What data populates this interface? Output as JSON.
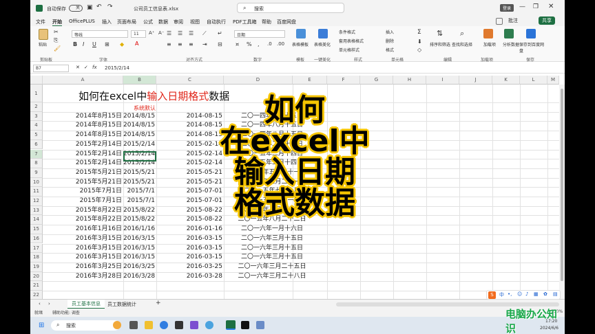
{
  "titlebar": {
    "autosave": "自动保存",
    "autosave_state": "关",
    "filename": "公司员工信息表.xlsx",
    "search": "搜索",
    "user": "登录",
    "share": "共享"
  },
  "tabs": [
    "文件",
    "开始",
    "OfficePLUS",
    "插入",
    "页面布局",
    "公式",
    "数据",
    "审阅",
    "视图",
    "自动执行",
    "PDF工具箱",
    "帮助",
    "百度网盘"
  ],
  "ribbon": {
    "paste": "粘贴",
    "clipboard": "剪贴板",
    "font_name": "等线",
    "font_size": "11",
    "font": "字体",
    "align": "对齐方式",
    "num_format": "日期",
    "number": "数字",
    "template": "表格模板",
    "template_group": "模板",
    "beautify": "表格美化",
    "beautify_group": "一键美化",
    "cond": "条件格式",
    "table_fmt": "套用表格格式",
    "cell_style": "单元格样式",
    "style": "样式",
    "insert": "插入",
    "delete": "删除",
    "format": "格式",
    "cells": "单元格",
    "sort": "排序和筛选",
    "find": "查找和选择",
    "edit": "编辑",
    "addin": "加载项",
    "addin_group": "加载项",
    "analyze": "分析数据",
    "save_baidu": "保存到百度网盘",
    "save": "保存",
    "bold": "B",
    "italic": "I",
    "underline": "U",
    "percent": "%",
    "comma": ","
  },
  "formula_bar": {
    "name_box": "B7",
    "fx": "fx",
    "value": "2015/2/14"
  },
  "columns": [
    "A",
    "B",
    "C",
    "D",
    "E",
    "F",
    "G",
    "H",
    "I",
    "J",
    "K",
    "L",
    "M"
  ],
  "rows": [
    "1",
    "2",
    "3",
    "4",
    "5",
    "6",
    "7",
    "8",
    "9",
    "10",
    "11",
    "12",
    "13",
    "14",
    "15",
    "16",
    "17",
    "18",
    "19",
    "20",
    "21",
    "22"
  ],
  "sheet": {
    "title_black_a": "如何在excel中",
    "title_red": "输入日期格式",
    "title_black_b": "数据",
    "b2": "系统默认",
    "data": [
      [
        "2014年8月15日",
        "2014/8/15",
        "2014-08-15",
        "二〇一四年八月十五日"
      ],
      [
        "2014年8月15日",
        "2014/8/15",
        "2014-08-15",
        "二〇一四年八月十五日"
      ],
      [
        "2014年8月15日",
        "2014/8/15",
        "2014-08-15",
        "二〇一四年八月十五日"
      ],
      [
        "2015年2月14日",
        "2015/2/14",
        "2015-02-14",
        "二〇一五年二月十四日"
      ],
      [
        "2015年2月14日",
        "2015/2/14",
        "2015-02-14",
        "二〇一五年二月十四日"
      ],
      [
        "2015年2月14日",
        "2015/2/14",
        "2015-02-14",
        "二〇一五年二月十四日"
      ],
      [
        "2015年5月21日",
        "2015/5/21",
        "2015-05-21",
        "二〇一五年五月二十一日"
      ],
      [
        "2015年5月21日",
        "2015/5/21",
        "2015-05-21",
        "二〇一五年五月二十一日"
      ],
      [
        "2015年7月1日",
        "2015/7/1",
        "2015-07-01",
        "二〇一五年七月一日"
      ],
      [
        "2015年7月1日",
        "2015/7/1",
        "2015-07-01",
        "二〇一五年七月一日"
      ],
      [
        "2015年8月22日",
        "2015/8/22",
        "2015-08-22",
        "二〇一五年八月二十二日"
      ],
      [
        "2015年8月22日",
        "2015/8/22",
        "2015-08-22",
        "二〇一五年八月二十二日"
      ],
      [
        "2016年1月16日",
        "2016/1/16",
        "2016-01-16",
        "二〇一六年一月十六日"
      ],
      [
        "2016年3月15日",
        "2016/3/15",
        "2016-03-15",
        "二〇一六年三月十五日"
      ],
      [
        "2016年3月15日",
        "2016/3/15",
        "2016-03-15",
        "二〇一六年三月十五日"
      ],
      [
        "2016年3月15日",
        "2016/3/15",
        "2016-03-15",
        "二〇一六年三月十五日"
      ],
      [
        "2016年3月25日",
        "2016/3/25",
        "2016-03-25",
        "二〇一六年三月二十五日"
      ],
      [
        "2016年3月28日",
        "2016/3/28",
        "2016-03-28",
        "二〇一六年三月二十八日"
      ]
    ]
  },
  "sheet_tabs": [
    "员工基本信息",
    "员工数据统计"
  ],
  "status": {
    "ready": "就绪",
    "accessibility": "辅助功能: 调查",
    "zoom": "130%"
  },
  "taskbar": {
    "search": "搜索",
    "time": "17:20",
    "date": "2024/6/6"
  },
  "overlay": [
    "如何",
    "在excel中",
    "输入日期",
    "格式数据"
  ],
  "watermark": "电脑办公知识"
}
